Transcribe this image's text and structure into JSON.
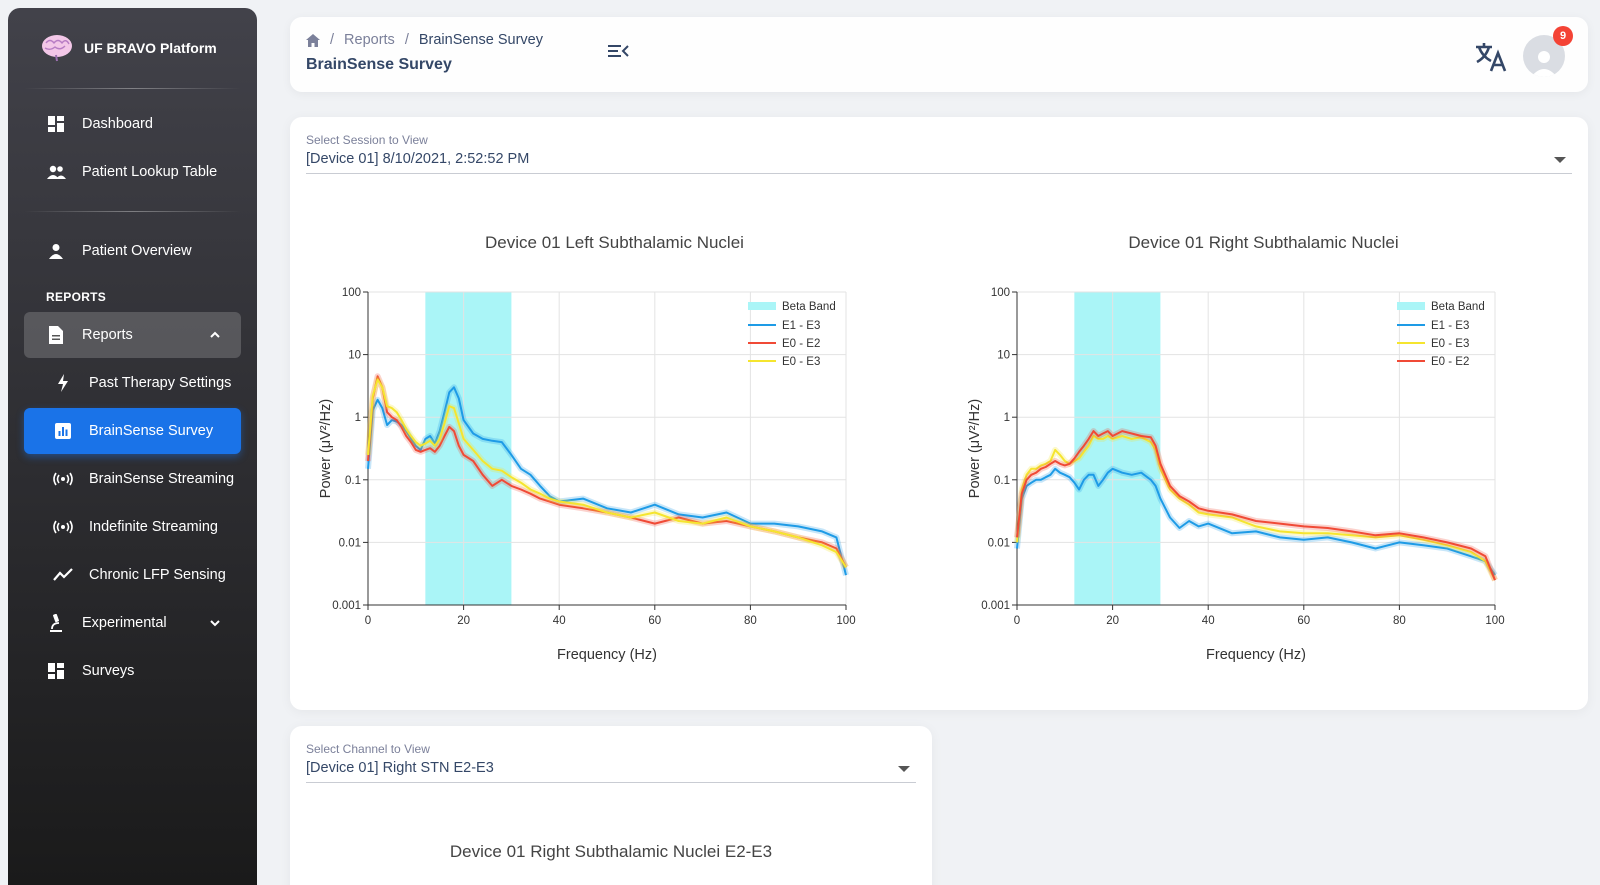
{
  "sidebar": {
    "brand": "UF BRAVO Platform",
    "nav_top": [
      {
        "label": "Dashboard",
        "icon": "dashboard-icon"
      },
      {
        "label": "Patient Lookup Table",
        "icon": "people-icon"
      }
    ],
    "patient_overview": {
      "label": "Patient Overview",
      "icon": "person-icon"
    },
    "section_title": "REPORTS",
    "reports": {
      "label": "Reports",
      "icon": "document-icon"
    },
    "report_items": [
      {
        "label": "Past Therapy Settings",
        "icon": "bolt-icon"
      },
      {
        "label": "BrainSense Survey",
        "icon": "bar-chart-icon",
        "active": true
      },
      {
        "label": "BrainSense Streaming",
        "icon": "broadcast-icon"
      },
      {
        "label": "Indefinite Streaming",
        "icon": "broadcast-icon"
      },
      {
        "label": "Chronic LFP Sensing",
        "icon": "trend-icon"
      }
    ],
    "experimental": {
      "label": "Experimental",
      "icon": "microscope-icon"
    },
    "surveys": {
      "label": "Surveys",
      "icon": "dashboard-icon"
    }
  },
  "header": {
    "breadcrumb": [
      "Reports",
      "BrainSense Survey"
    ],
    "title": "BrainSense Survey",
    "notification_count": "9"
  },
  "session_select": {
    "label": "Select Session to View",
    "value": "[Device 01] 8/10/2021, 2:52:52 PM"
  },
  "channel_select": {
    "label": "Select Channel to View",
    "value": "[Device 01] Right STN E2-E3"
  },
  "chart3_title": "Device 01 Right Subthalamic Nuclei E2-E3",
  "colors": {
    "accent": "#1a73e8",
    "beta": "#aaf5f7",
    "blue": "#1e9be6",
    "red": "#f04a36",
    "yellow": "#f5e52f",
    "badge": "#f44335"
  },
  "chart_data": [
    {
      "type": "line",
      "title": "Device 01 Left Subthalamic Nuclei",
      "xlabel": "Frequency (Hz)",
      "ylabel": "Power (μV²/Hz)",
      "xlim": [
        0,
        100
      ],
      "ylim": [
        0.001,
        100
      ],
      "yscale": "log",
      "xticks": [
        "0",
        "20",
        "40",
        "60",
        "80",
        "100"
      ],
      "yticks": [
        "0.001",
        "0.01",
        "0.1",
        "1",
        "10",
        "100"
      ],
      "grid": true,
      "legend_position": "top-right",
      "band": {
        "name": "Beta Band",
        "x": [
          12,
          30
        ]
      },
      "series": [
        {
          "name": "E1 - E3",
          "color": "#1e9be6",
          "x": [
            0,
            1,
            2,
            3,
            4,
            5,
            6,
            7,
            8,
            9,
            10,
            11,
            12,
            13,
            14,
            15,
            16,
            17,
            18,
            19,
            20,
            22,
            24,
            26,
            28,
            30,
            32,
            34,
            36,
            38,
            40,
            45,
            50,
            55,
            60,
            65,
            70,
            75,
            80,
            85,
            90,
            95,
            98,
            100
          ],
          "y": [
            0.15,
            1.3,
            1.9,
            1.4,
            0.75,
            0.9,
            0.85,
            0.75,
            0.6,
            0.45,
            0.35,
            0.3,
            0.45,
            0.5,
            0.38,
            0.6,
            1.2,
            2.5,
            3,
            2,
            0.9,
            0.55,
            0.45,
            0.42,
            0.4,
            0.25,
            0.15,
            0.12,
            0.08,
            0.055,
            0.045,
            0.05,
            0.035,
            0.03,
            0.04,
            0.028,
            0.025,
            0.03,
            0.02,
            0.02,
            0.018,
            0.015,
            0.012,
            0.003
          ]
        },
        {
          "name": "E0 - E2",
          "color": "#f04a36",
          "x": [
            0,
            1,
            2,
            3,
            4,
            5,
            6,
            7,
            8,
            9,
            10,
            11,
            12,
            13,
            14,
            15,
            16,
            17,
            18,
            19,
            20,
            22,
            24,
            26,
            28,
            30,
            32,
            34,
            36,
            38,
            40,
            45,
            50,
            55,
            60,
            65,
            70,
            75,
            80,
            85,
            90,
            95,
            98,
            100
          ],
          "y": [
            0.2,
            2,
            4.5,
            3,
            1.2,
            1.0,
            0.9,
            0.7,
            0.5,
            0.4,
            0.3,
            0.28,
            0.3,
            0.32,
            0.28,
            0.35,
            0.5,
            0.7,
            0.6,
            0.35,
            0.25,
            0.2,
            0.12,
            0.08,
            0.1,
            0.08,
            0.07,
            0.06,
            0.05,
            0.045,
            0.04,
            0.035,
            0.03,
            0.025,
            0.02,
            0.025,
            0.02,
            0.022,
            0.018,
            0.015,
            0.012,
            0.01,
            0.008,
            0.004
          ]
        },
        {
          "name": "E0 - E3",
          "color": "#f5e52f",
          "x": [
            0,
            1,
            2,
            3,
            4,
            5,
            6,
            7,
            8,
            9,
            10,
            11,
            12,
            13,
            14,
            15,
            16,
            17,
            18,
            19,
            20,
            22,
            24,
            26,
            28,
            30,
            32,
            34,
            36,
            38,
            40,
            45,
            50,
            55,
            60,
            65,
            70,
            75,
            80,
            85,
            90,
            95,
            98,
            100
          ],
          "y": [
            0.25,
            2.2,
            4,
            3,
            1.5,
            1.4,
            1.2,
            0.9,
            0.65,
            0.5,
            0.4,
            0.35,
            0.38,
            0.42,
            0.35,
            0.45,
            0.8,
            1.5,
            1.4,
            0.8,
            0.45,
            0.3,
            0.2,
            0.15,
            0.14,
            0.11,
            0.09,
            0.07,
            0.06,
            0.05,
            0.045,
            0.04,
            0.03,
            0.025,
            0.03,
            0.022,
            0.02,
            0.025,
            0.018,
            0.015,
            0.012,
            0.009,
            0.007,
            0.004
          ]
        }
      ]
    },
    {
      "type": "line",
      "title": "Device 01 Right Subthalamic Nuclei",
      "xlabel": "Frequency (Hz)",
      "ylabel": "Power (μV²/Hz)",
      "xlim": [
        0,
        100
      ],
      "ylim": [
        0.001,
        100
      ],
      "yscale": "log",
      "xticks": [
        "0",
        "20",
        "40",
        "60",
        "80",
        "100"
      ],
      "yticks": [
        "0.001",
        "0.01",
        "0.1",
        "1",
        "10",
        "100"
      ],
      "grid": true,
      "legend_position": "top-right",
      "band": {
        "name": "Beta Band",
        "x": [
          12,
          30
        ]
      },
      "series": [
        {
          "name": "E1 - E3",
          "color": "#1e9be6",
          "x": [
            0,
            1,
            2,
            3,
            4,
            5,
            6,
            7,
            8,
            9,
            10,
            11,
            12,
            13,
            14,
            15,
            16,
            17,
            18,
            19,
            20,
            22,
            24,
            26,
            28,
            29,
            30,
            32,
            34,
            36,
            38,
            40,
            45,
            50,
            55,
            60,
            65,
            70,
            75,
            80,
            85,
            90,
            95,
            98,
            100
          ],
          "y": [
            0.008,
            0.05,
            0.08,
            0.09,
            0.1,
            0.1,
            0.11,
            0.12,
            0.15,
            0.13,
            0.12,
            0.11,
            0.09,
            0.07,
            0.1,
            0.12,
            0.12,
            0.08,
            0.1,
            0.13,
            0.15,
            0.13,
            0.12,
            0.13,
            0.1,
            0.08,
            0.05,
            0.025,
            0.017,
            0.022,
            0.018,
            0.02,
            0.014,
            0.015,
            0.012,
            0.011,
            0.012,
            0.01,
            0.008,
            0.01,
            0.009,
            0.008,
            0.006,
            0.005,
            0.003
          ]
        },
        {
          "name": "E0 - E3",
          "color": "#f5e52f",
          "x": [
            0,
            1,
            2,
            3,
            4,
            5,
            6,
            7,
            8,
            9,
            10,
            11,
            12,
            13,
            14,
            15,
            16,
            17,
            18,
            19,
            20,
            22,
            24,
            26,
            28,
            29,
            30,
            32,
            34,
            36,
            38,
            40,
            45,
            50,
            55,
            60,
            65,
            70,
            75,
            80,
            85,
            90,
            95,
            98,
            100
          ],
          "y": [
            0.01,
            0.07,
            0.12,
            0.15,
            0.15,
            0.17,
            0.18,
            0.2,
            0.3,
            0.25,
            0.2,
            0.18,
            0.2,
            0.22,
            0.28,
            0.35,
            0.5,
            0.45,
            0.45,
            0.5,
            0.45,
            0.5,
            0.45,
            0.48,
            0.4,
            0.3,
            0.15,
            0.07,
            0.05,
            0.04,
            0.03,
            0.028,
            0.025,
            0.018,
            0.015,
            0.014,
            0.014,
            0.013,
            0.012,
            0.013,
            0.011,
            0.009,
            0.007,
            0.005,
            0.0025
          ]
        },
        {
          "name": "E0 - E2",
          "color": "#f04a36",
          "x": [
            0,
            1,
            2,
            3,
            4,
            5,
            6,
            7,
            8,
            9,
            10,
            11,
            12,
            13,
            14,
            15,
            16,
            17,
            18,
            19,
            20,
            22,
            24,
            26,
            28,
            29,
            30,
            32,
            34,
            36,
            38,
            40,
            45,
            50,
            55,
            60,
            65,
            70,
            75,
            80,
            85,
            90,
            95,
            98,
            100
          ],
          "y": [
            0.012,
            0.06,
            0.1,
            0.12,
            0.13,
            0.15,
            0.16,
            0.18,
            0.2,
            0.18,
            0.17,
            0.18,
            0.22,
            0.28,
            0.35,
            0.45,
            0.6,
            0.5,
            0.55,
            0.6,
            0.5,
            0.6,
            0.55,
            0.5,
            0.48,
            0.35,
            0.18,
            0.08,
            0.055,
            0.045,
            0.035,
            0.032,
            0.028,
            0.022,
            0.02,
            0.018,
            0.017,
            0.015,
            0.013,
            0.014,
            0.012,
            0.01,
            0.008,
            0.006,
            0.0025
          ]
        }
      ]
    }
  ]
}
